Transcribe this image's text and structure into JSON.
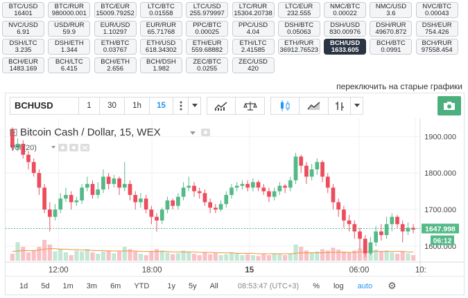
{
  "pairs": [
    [
      {
        "name": "BTC/USD",
        "value": "16401"
      },
      {
        "name": "BTC/RUR",
        "value": "980000.001"
      },
      {
        "name": "BTC/EUR",
        "value": "15009.79252"
      },
      {
        "name": "LTC/BTC",
        "value": "0.01558"
      },
      {
        "name": "LTC/USD",
        "value": "255.979997"
      },
      {
        "name": "LTC/RUR",
        "value": "15304.20738"
      },
      {
        "name": "LTC/EUR",
        "value": "232.555"
      },
      {
        "name": "NMC/BTC",
        "value": "0.00022"
      },
      {
        "name": "NMC/USD",
        "value": "3.6"
      },
      {
        "name": "NVC/BTC",
        "value": "0.00043"
      }
    ],
    [
      {
        "name": "NVC/USD",
        "value": "6.91"
      },
      {
        "name": "USD/RUR",
        "value": "59.9"
      },
      {
        "name": "EUR/USD",
        "value": "1.10297"
      },
      {
        "name": "EUR/RUR",
        "value": "65.71768"
      },
      {
        "name": "PPC/BTC",
        "value": "0.00025"
      },
      {
        "name": "PPC/USD",
        "value": "4.04"
      },
      {
        "name": "DSH/BTC",
        "value": "0.05063"
      },
      {
        "name": "DSH/USD",
        "value": "830.00976"
      },
      {
        "name": "DSH/RUR",
        "value": "49670.872"
      },
      {
        "name": "DSH/EUR",
        "value": "754.426"
      }
    ],
    [
      {
        "name": "DSH/LTC",
        "value": "3.235"
      },
      {
        "name": "DSH/ETH",
        "value": "1.344"
      },
      {
        "name": "ETH/BTC",
        "value": "0.03767"
      },
      {
        "name": "ETH/USD",
        "value": "618.34302"
      },
      {
        "name": "ETH/EUR",
        "value": "559.68882"
      },
      {
        "name": "ETH/LTC",
        "value": "2.41585"
      },
      {
        "name": "ETH/RUR",
        "value": "36912.76523"
      },
      {
        "name": "BCH/USD",
        "value": "1633.605",
        "active": true
      },
      {
        "name": "BCH/BTC",
        "value": "0.0991"
      },
      {
        "name": "BCH/RUR",
        "value": "97558.454"
      }
    ],
    [
      {
        "name": "BCH/EUR",
        "value": "1483.169"
      },
      {
        "name": "BCH/LTC",
        "value": "6.415"
      },
      {
        "name": "BCH/ETH",
        "value": "2.656"
      },
      {
        "name": "BCH/DSH",
        "value": "1.982"
      },
      {
        "name": "ZEC/BTC",
        "value": "0.0255"
      },
      {
        "name": "ZEC/USD",
        "value": "420"
      }
    ]
  ],
  "switch_link": "переключить на старые графики",
  "toolbar": {
    "symbol": "BCHUSD",
    "intervals": [
      "1",
      "30",
      "1h",
      "15"
    ],
    "active_interval": "15"
  },
  "legend": {
    "title": "Bitcoin Cash / Dollar, 15, WEX",
    "volume": "Vol (20)"
  },
  "price_axis": {
    "ticks": [
      "1900.000",
      "1800.000",
      "1700.000",
      "1600.000"
    ],
    "last_price": "1647.998",
    "countdown": "06:12"
  },
  "time_axis": {
    "ticks": [
      "12:00",
      "18:00",
      "15",
      "06:00",
      "10:"
    ]
  },
  "bottom": {
    "ranges": [
      "1d",
      "5d",
      "1m",
      "3m",
      "6m",
      "YTD",
      "1y",
      "5y",
      "All"
    ],
    "clock": "08:53:47 (UTC+3)",
    "percent": "%",
    "log": "log",
    "auto": "auto"
  },
  "colors": {
    "up": "#53b987",
    "down": "#eb4d5c",
    "accent": "#2196f3",
    "active_pair": "#2a3442"
  },
  "chart_data": {
    "type": "candlestick",
    "title": "Bitcoin Cash / Dollar, 15, WEX",
    "ylim": [
      1560,
      1950
    ],
    "y_ticks": [
      1900,
      1800,
      1700,
      1600
    ],
    "x_ticks": [
      "12:00",
      "18:00",
      "15",
      "06:00",
      "10:"
    ],
    "last_price": 1647.998,
    "candles": [
      [
        1920,
        1870,
        1925,
        1860
      ],
      [
        1870,
        1880,
        1895,
        1860
      ],
      [
        1880,
        1850,
        1890,
        1840
      ],
      [
        1850,
        1830,
        1860,
        1810
      ],
      [
        1830,
        1800,
        1840,
        1790
      ],
      [
        1800,
        1760,
        1810,
        1740
      ],
      [
        1760,
        1700,
        1770,
        1690
      ],
      [
        1700,
        1680,
        1720,
        1640
      ],
      [
        1680,
        1700,
        1715,
        1670
      ],
      [
        1700,
        1730,
        1745,
        1690
      ],
      [
        1730,
        1740,
        1760,
        1720
      ],
      [
        1740,
        1720,
        1750,
        1700
      ],
      [
        1720,
        1725,
        1735,
        1710
      ],
      [
        1725,
        1760,
        1770,
        1715
      ],
      [
        1760,
        1770,
        1790,
        1750
      ],
      [
        1770,
        1740,
        1780,
        1730
      ],
      [
        1740,
        1755,
        1775,
        1730
      ],
      [
        1755,
        1790,
        1810,
        1745
      ],
      [
        1790,
        1770,
        1800,
        1755
      ],
      [
        1770,
        1785,
        1795,
        1760
      ],
      [
        1785,
        1760,
        1790,
        1740
      ],
      [
        1760,
        1770,
        1830,
        1750
      ],
      [
        1770,
        1740,
        1780,
        1725
      ],
      [
        1740,
        1720,
        1750,
        1700
      ],
      [
        1720,
        1730,
        1745,
        1705
      ],
      [
        1730,
        1700,
        1740,
        1690
      ],
      [
        1700,
        1680,
        1710,
        1660
      ],
      [
        1680,
        1670,
        1690,
        1640
      ],
      [
        1670,
        1700,
        1705,
        1660
      ],
      [
        1700,
        1725,
        1735,
        1690
      ],
      [
        1725,
        1710,
        1730,
        1700
      ],
      [
        1710,
        1735,
        1745,
        1700
      ],
      [
        1735,
        1760,
        1775,
        1725
      ],
      [
        1760,
        1765,
        1790,
        1750
      ],
      [
        1765,
        1750,
        1775,
        1735
      ],
      [
        1750,
        1745,
        1760,
        1730
      ],
      [
        1745,
        1720,
        1755,
        1710
      ],
      [
        1720,
        1705,
        1730,
        1690
      ],
      [
        1705,
        1700,
        1715,
        1690
      ],
      [
        1700,
        1715,
        1725,
        1695
      ],
      [
        1715,
        1740,
        1750,
        1705
      ],
      [
        1740,
        1760,
        1770,
        1730
      ],
      [
        1760,
        1765,
        1775,
        1750
      ],
      [
        1765,
        1770,
        1780,
        1755
      ],
      [
        1770,
        1760,
        1780,
        1750
      ],
      [
        1760,
        1775,
        1785,
        1750
      ],
      [
        1775,
        1760,
        1780,
        1750
      ],
      [
        1760,
        1750,
        1770,
        1740
      ],
      [
        1750,
        1735,
        1760,
        1720
      ],
      [
        1735,
        1750,
        1760,
        1725
      ],
      [
        1750,
        1765,
        1775,
        1740
      ],
      [
        1765,
        1760,
        1770,
        1745
      ],
      [
        1760,
        1780,
        1790,
        1750
      ],
      [
        1780,
        1845,
        1855,
        1770
      ],
      [
        1845,
        1820,
        1850,
        1800
      ],
      [
        1820,
        1790,
        1830,
        1770
      ],
      [
        1790,
        1810,
        1825,
        1780
      ],
      [
        1810,
        1830,
        1840,
        1795
      ],
      [
        1830,
        1790,
        1835,
        1775
      ],
      [
        1790,
        1760,
        1800,
        1745
      ],
      [
        1760,
        1720,
        1770,
        1700
      ],
      [
        1720,
        1700,
        1730,
        1680
      ],
      [
        1700,
        1670,
        1710,
        1650
      ],
      [
        1670,
        1660,
        1685,
        1640
      ],
      [
        1660,
        1640,
        1670,
        1620
      ],
      [
        1640,
        1620,
        1650,
        1590
      ],
      [
        1620,
        1580,
        1630,
        1570
      ],
      [
        1580,
        1610,
        1625,
        1575
      ],
      [
        1610,
        1640,
        1655,
        1600
      ],
      [
        1640,
        1630,
        1660,
        1615
      ],
      [
        1630,
        1660,
        1680,
        1620
      ],
      [
        1660,
        1680,
        1690,
        1640
      ],
      [
        1680,
        1660,
        1685,
        1650
      ],
      [
        1660,
        1640,
        1670,
        1610
      ],
      [
        1640,
        1650,
        1665,
        1630
      ],
      [
        1650,
        1645,
        1660,
        1635
      ]
    ],
    "volumes": [
      15,
      40,
      30,
      18,
      22,
      30,
      45,
      35,
      20,
      25,
      18,
      12,
      22,
      20,
      25,
      18,
      15,
      20,
      22,
      16,
      20,
      30,
      25,
      20,
      15,
      12,
      20,
      25,
      22,
      18,
      14,
      16,
      22,
      20,
      15,
      12,
      18,
      14,
      16,
      12,
      14,
      18,
      16,
      12,
      14,
      12,
      10,
      14,
      12,
      16,
      14,
      12,
      15,
      35,
      30,
      22,
      18,
      20,
      25,
      22,
      28,
      24,
      20,
      18,
      22,
      26,
      30,
      28,
      24,
      20,
      22,
      18,
      15,
      20,
      16,
      12
    ],
    "ma": [
      20,
      21,
      22,
      22,
      22,
      23,
      25,
      26,
      26,
      25,
      25,
      24,
      24,
      23,
      23,
      22,
      22,
      22,
      21,
      21,
      21,
      21,
      21,
      21,
      20,
      20,
      20,
      20,
      20,
      20,
      19,
      19,
      19,
      19,
      19,
      18,
      18,
      18,
      17,
      17,
      17,
      17,
      16,
      16,
      16,
      16,
      15,
      15,
      15,
      15,
      15,
      15,
      15,
      16,
      17,
      17,
      17,
      17,
      17,
      18,
      18,
      18,
      18,
      18,
      18,
      19,
      19,
      20,
      20,
      20,
      20,
      20,
      20,
      20,
      19,
      19
    ]
  }
}
